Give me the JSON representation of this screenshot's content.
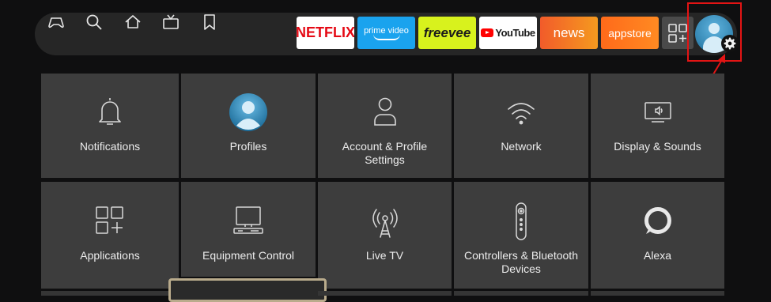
{
  "nav": {
    "icons": [
      "gamepad-icon",
      "search-icon",
      "home-icon",
      "live-tv-icon",
      "bookmark-icon"
    ]
  },
  "apps": {
    "netflix": "NETFLIX",
    "prime": "prime video",
    "freevee": "freevee",
    "youtube": "YouTube",
    "news": "news",
    "appstore": "appstore"
  },
  "settings": {
    "row1": [
      {
        "label": "Notifications",
        "icon": "bell-icon"
      },
      {
        "label": "Profiles",
        "icon": "profile-avatar-icon"
      },
      {
        "label": "Account & Profile Settings",
        "icon": "person-icon"
      },
      {
        "label": "Network",
        "icon": "wifi-icon"
      },
      {
        "label": "Display & Sounds",
        "icon": "display-sound-icon"
      }
    ],
    "row2": [
      {
        "label": "Applications",
        "icon": "apps-grid-icon"
      },
      {
        "label": "Equipment Control",
        "icon": "equipment-icon"
      },
      {
        "label": "Live TV",
        "icon": "antenna-icon"
      },
      {
        "label": "Controllers & Bluetooth Devices",
        "icon": "remote-icon"
      },
      {
        "label": "Alexa",
        "icon": "alexa-icon"
      }
    ]
  },
  "colors": {
    "background": "#0f0f10",
    "tile": "#3d3d3d",
    "highlight": "#e31414",
    "netflix_red": "#e50914",
    "prime_blue": "#1aa3ee",
    "freevee_yellow": "#d8f21d"
  }
}
